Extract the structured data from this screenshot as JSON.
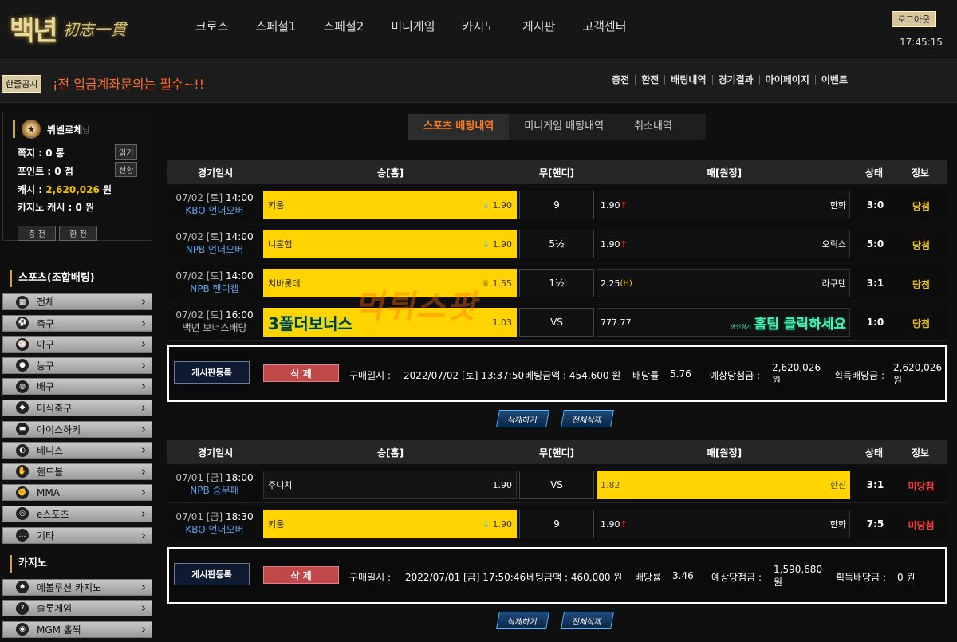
{
  "header": {
    "logo_main": "백년",
    "logo_sub": "初志一貫",
    "nav": [
      "크로스",
      "스페셜1",
      "스페셜2",
      "미니게임",
      "카지노",
      "게시판",
      "고객센터"
    ],
    "logout": "로그아웃",
    "clock": "17:45:15"
  },
  "subbar": {
    "notice_badge": "한줄공지",
    "notice_text": "¡전 입금계좌문의는 필수~!!",
    "quick": [
      "충전",
      "환전",
      "배팅내역",
      "경기결과",
      "마이페이지",
      "이벤트"
    ]
  },
  "user": {
    "name": "뷔넬로체",
    "suffix": "님",
    "note_label": "쪽지 : ",
    "note_value": "0",
    "note_unit": " 통",
    "note_btn": "읽기",
    "point_label": "포인트 : ",
    "point_value": "0",
    "point_unit": " 점",
    "point_btn": "전환",
    "cash_label": "캐시 : ",
    "cash_value": "2,620,026",
    "cash_unit": " 원",
    "casino_label": "카지노 캐시 : ",
    "casino_value": "0",
    "casino_unit": " 원",
    "charge_btn": "충 전",
    "exchange_btn": "환 전"
  },
  "sports_menu": {
    "title": "스포츠(조합배팅)",
    "items": [
      "전체",
      "축구",
      "야구",
      "농구",
      "배구",
      "미식축구",
      "아이스하키",
      "테니스",
      "핸드볼",
      "MMA",
      "e스포츠",
      "기타"
    ]
  },
  "casino_menu": {
    "title": "카지노",
    "items": [
      "에볼루션 카지노",
      "슬롯게임",
      "MGM 홀짝"
    ]
  },
  "tabs": [
    "스포츠 배팅내역",
    "미니게임 배팅내역",
    "취소내역"
  ],
  "columns": [
    "경기일시",
    "승[홈]",
    "무[핸디]",
    "패[원정]",
    "상태",
    "정보"
  ],
  "bets": [
    {
      "rows": [
        {
          "date": "07/02 [토]",
          "time": "14:00",
          "league": "KBO 언더오버",
          "home": "키움",
          "home_odds": "1.90",
          "draw": "9",
          "away_odds": "1.90",
          "away": "한화",
          "score": "3:0",
          "status": "당첨"
        },
        {
          "date": "07/02 [토]",
          "time": "14:00",
          "league": "NPB 언더오버",
          "home": "니혼햄",
          "home_odds": "1.90",
          "draw": "5½",
          "away_odds": "1.90",
          "away": "오릭스",
          "score": "5:0",
          "status": "당첨"
        },
        {
          "date": "07/02 [토]",
          "time": "14:00",
          "league": "NPB 핸디캡",
          "home": "치바롯데",
          "home_odds": "1.55",
          "draw": "1½",
          "away_odds": "2.25",
          "away": "라쿠텐",
          "score": "3:1",
          "status": "당첨"
        },
        {
          "date": "07/02 [토]",
          "time": "16:00",
          "league": "백년 보너스배당",
          "home": "3폴더보너스",
          "home_odds": "1.03",
          "draw": "VS",
          "away_odds": "777.77",
          "away": "홈팀 클릭하세요",
          "score": "1:0",
          "status": "당첨"
        }
      ],
      "summary": {
        "board_btn": "게시판등록",
        "delete_btn": "삭 제",
        "purchase_label": "구매일시 :",
        "purchase": "2022/07/02 [토] 13:37:50",
        "amount_label": "베팅금액 : ",
        "amount": "454,600 원",
        "odds_label": "배당률",
        "odds": "5.76",
        "expected_label": "예상당첨금 :",
        "expected": "2,620,026",
        "expected_unit": "원",
        "won_label": "획득배당금 :",
        "won": "2,620,026",
        "won_unit": "원"
      },
      "actions": [
        "삭제하기",
        "전체삭제"
      ]
    },
    {
      "rows": [
        {
          "date": "07/01 [금]",
          "time": "18:00",
          "league": "NPB 승무패",
          "home": "주니치",
          "home_odds": "1.90",
          "draw": "VS",
          "away_odds": "1.82",
          "away": "한신",
          "score": "3:1",
          "status": "미당첨"
        },
        {
          "date": "07/01 [금]",
          "time": "18:30",
          "league": "KBO 언더오버",
          "home": "키움",
          "home_odds": "1.90",
          "draw": "9",
          "away_odds": "1.90",
          "away": "한화",
          "score": "7:5",
          "status": "미당첨"
        }
      ],
      "summary": {
        "board_btn": "게시판등록",
        "delete_btn": "삭 제",
        "purchase_label": "구매일시 :",
        "purchase": "2022/07/01 [금] 17:50:46",
        "amount_label": "베팅금액 : ",
        "amount": "460,000 원",
        "odds_label": "배당률",
        "odds": "3.46",
        "expected_label": "예상당첨금 :",
        "expected": "1,590,680",
        "expected_unit": "원",
        "won_label": "획득배당금 :",
        "won": "0 원",
        "won_unit": ""
      },
      "actions": [
        "삭제하기",
        "전체삭제"
      ]
    }
  ],
  "badges": {
    "hw": "(H)",
    "bonus_small": "항인경기"
  },
  "colors": {
    "selected": "#ffd400",
    "win": "#f0c400",
    "lose": "#ff3b3b",
    "accent": "#ff7a1a"
  },
  "watermark": "먹튀스팟"
}
